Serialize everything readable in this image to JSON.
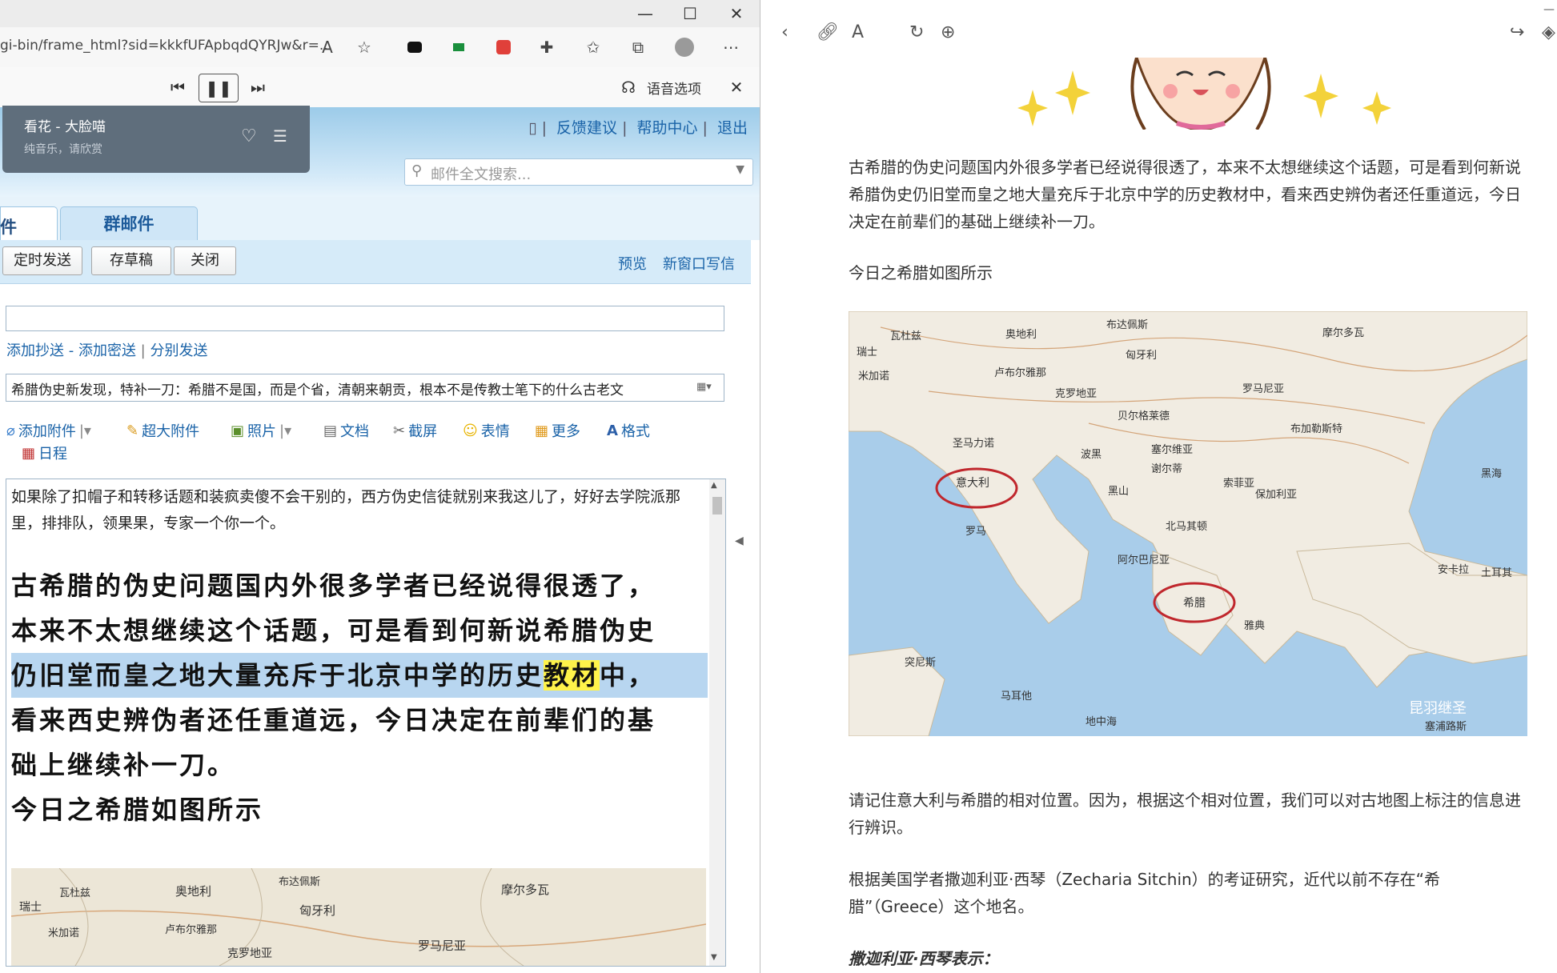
{
  "left_window": {
    "title_controls": {
      "minimize": "—",
      "maximize": "☐",
      "close": "✕"
    },
    "address_bar": {
      "url": "gi-bin/frame_html?sid=kkkfUFApbqdQYRJw&r=..."
    },
    "read_aloud": {
      "voice_options": "语音选项"
    },
    "music_card": {
      "title": "看花 - 大脸喵",
      "subtitle": "纯音乐，请欣赏"
    },
    "top_links": [
      "反馈建议",
      "帮助中心",
      "退出"
    ],
    "search": {
      "placeholder": "邮件全文搜索..."
    },
    "tabs": {
      "compose": "邮件",
      "group": "群邮件"
    },
    "actions": {
      "scheduled": "定时发送",
      "draft": "存草稿",
      "close": "关闭",
      "preview": "预览",
      "new_window": "新窗口写信"
    },
    "cc_links": {
      "add_cc": "添加抄送",
      "add_bcc": "添加密送",
      "separate": "分别发送",
      "dash": " - ",
      "bar": " | "
    },
    "subject": "希腊伪史新发现，特补一刀：希腊不是国，而是个省，清朝来朝贡，根本不是传教士笔下的什么古老文",
    "tools": {
      "attach": "添加附件",
      "big_attach": "超大附件",
      "photo": "照片",
      "doc": "文档",
      "screenshot": "截屏",
      "emoji": "表情",
      "more": "更多",
      "format": "格式",
      "schedule": "日程"
    },
    "editor": {
      "intro": "如果除了扣帽子和转移话题和装疯卖傻不会干别的，西方伪史信徒就别来我这儿了，好好去学院派那里，排排队，领果果，专家一个你一个。",
      "big_line1": "古希腊的伪史问题国内外很多学者已经说得很透了，",
      "big_line2": "本来不太想继续这个话题，可是看到何新说希腊伪史",
      "big_line3a": "仍旧堂而皇之地大量充斥于北京中学的历史",
      "big_line3b": "教材",
      "big_line3c": "中，",
      "big_line4": "看来西史辨伪者还任重道远，今日决定在前辈们的基",
      "big_line5": "础上继续补一刀。",
      "big_line6": "今日之希腊如图所示"
    }
  },
  "right_window": {
    "article": {
      "para1": "古希腊的伪史问题国内外很多学者已经说得很透了，本来不太想继续这个话题，可是看到何新说希腊伪史仍旧堂而皇之地大量充斥于北京中学的历史教材中，看来西史辨伪者还任重道远，今日决定在前辈们的基础上继续补一刀。",
      "para2": "今日之希腊如图所示",
      "para3": "请记住意大利与希腊的相对位置。因为，根据这个相对位置，我们可以对古地图上标注的信息进行辨识。",
      "para4": "根据美国学者撒迦利亚·西琴（Zecharia Sitchin）的考证研究，近代以前不存在“希腊”（Greece）这个地名。",
      "para5": "撒迦利亚·西琴表示："
    },
    "map": {
      "labels": {
        "switzerland": "瑞士",
        "vaduz": "瓦杜兹",
        "austria": "奥地利",
        "budapest": "布达佩斯",
        "moldova": "摩尔多瓦",
        "ljubljana": "卢布尔雅那",
        "hungary": "匈牙利",
        "croatia": "克罗地亚",
        "romania": "罗马尼亚",
        "belgrade": "贝尔格莱德",
        "bucharest": "布加勒斯特",
        "sanmarino": "圣马力诺",
        "bosnia": "波黑",
        "serbia": "塞尔维亚",
        "blacksea": "黑海",
        "italy": "意大利",
        "sarajevo": "谢尔蒂",
        "montenegro": "黑山",
        "sofia": "索菲亚",
        "bulgaria": "保加利亚",
        "rome": "罗马",
        "macedonia": "北马其顿",
        "albania": "阿尔巴尼亚",
        "greece": "希腊",
        "ankara": "安卡拉",
        "turkey": "土耳其",
        "athens": "雅典",
        "tunis": "突尼斯",
        "malta": "马耳他",
        "med": "地中海",
        "cyprus": "塞浦路斯",
        "watermark": "昆羽继圣",
        "milan": "米加诺"
      }
    }
  }
}
